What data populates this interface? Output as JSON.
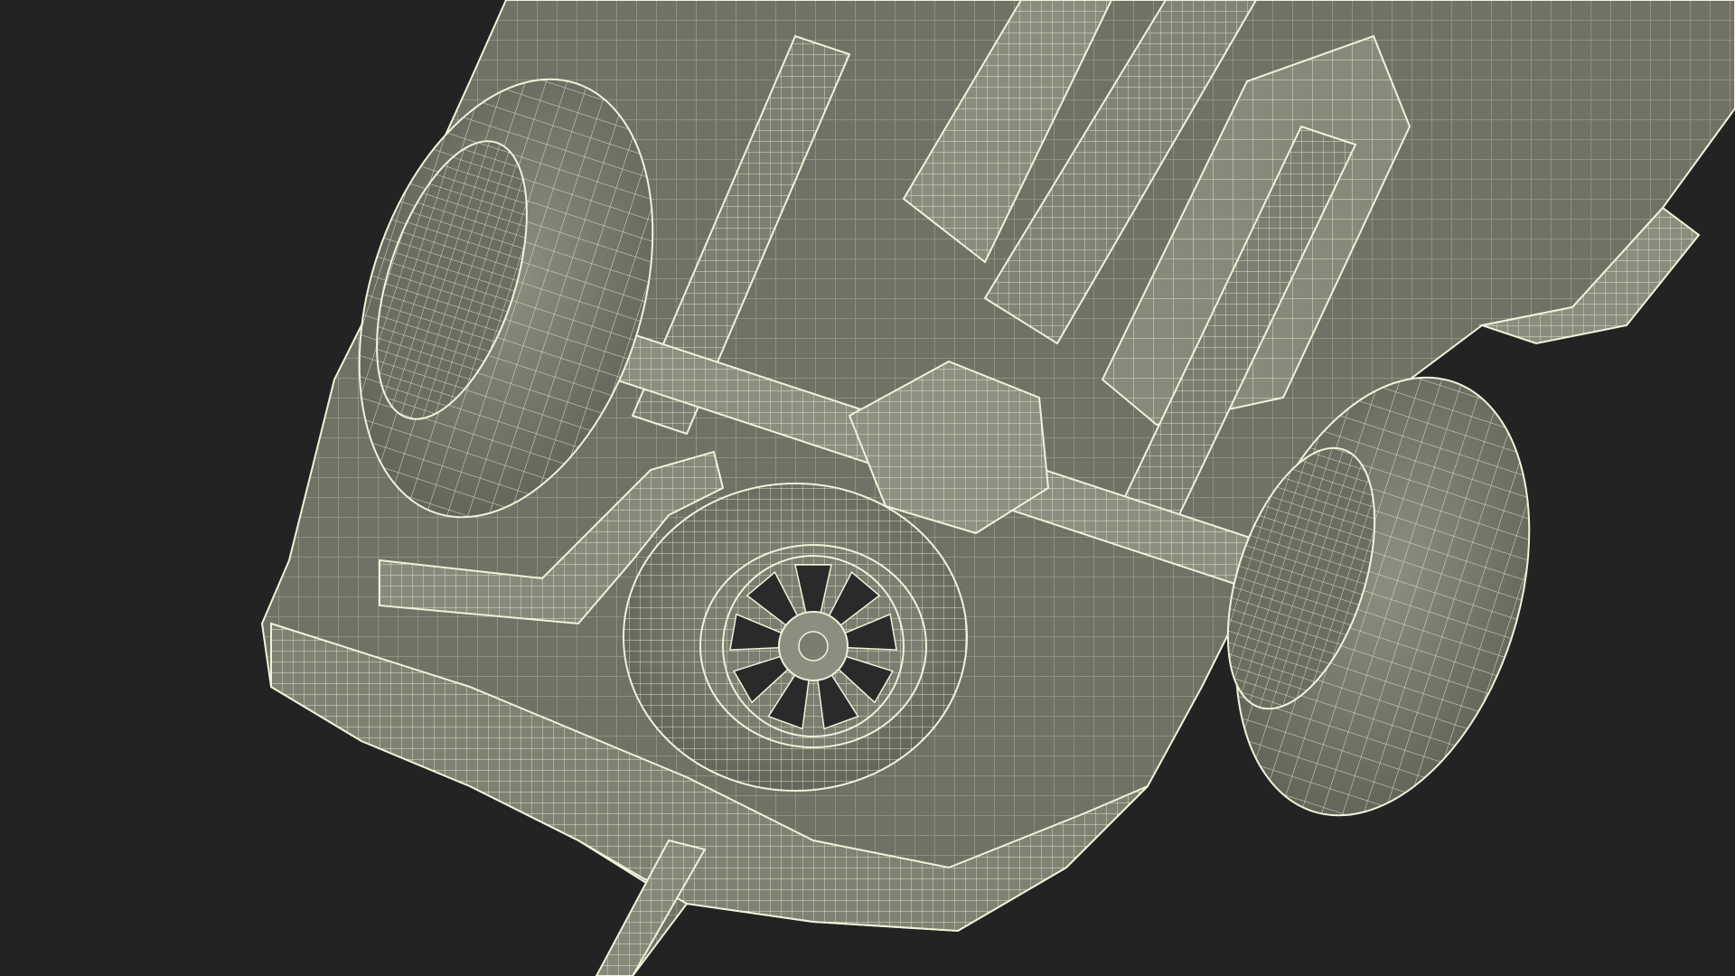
{
  "viewport": {
    "background_color": "#232323"
  },
  "render": {
    "style": "wireframe",
    "subject": "vehicle-underside",
    "surface_color": "#7f8273",
    "surface_dark_color": "#5e6155",
    "surface_light_color": "#9a9d8e",
    "wire_color": "#f2f1da"
  }
}
